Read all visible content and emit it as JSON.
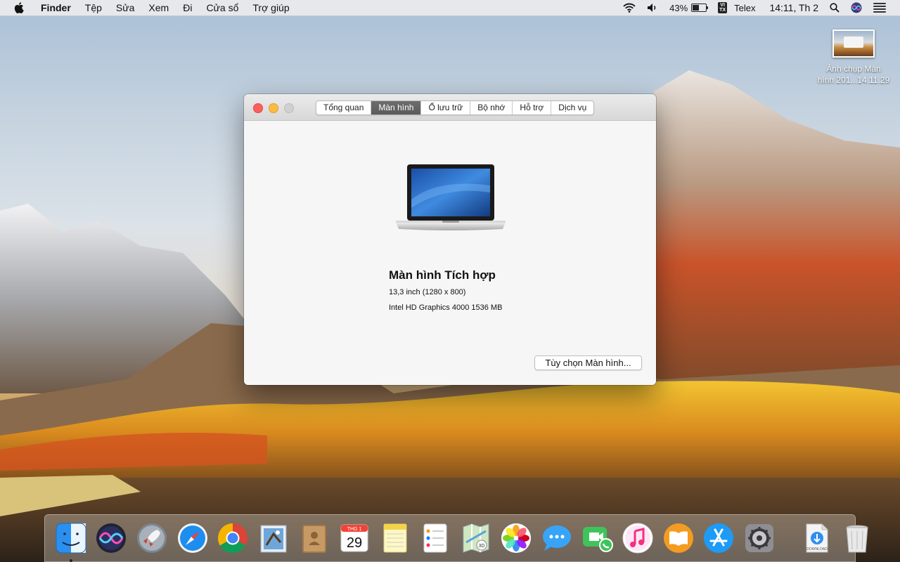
{
  "menubar": {
    "apple_icon": "apple-logo-icon",
    "app_name": "Finder",
    "menus": [
      "Tệp",
      "Sửa",
      "Xem",
      "Đi",
      "Cửa sổ",
      "Trợ giúp"
    ],
    "battery_percent": "43%",
    "battery_level": 0.43,
    "input_badge_top": "VI",
    "input_badge_bottom": "TX",
    "input_method": "Telex",
    "clock": "14:11, Th 2"
  },
  "desktop": {
    "screenshot_file_line1": "Ảnh chụp Màn",
    "screenshot_file_line2": "hình 201...14.11.29"
  },
  "window": {
    "tabs": [
      "Tổng quan",
      "Màn hình",
      "Ổ lưu trữ",
      "Bộ nhớ",
      "Hỗ trợ",
      "Dịch vụ"
    ],
    "active_tab": "Màn hình",
    "display_title": "Màn hình Tích hợp",
    "display_size": "13,3 inch (1280 x 800)",
    "graphics": "Intel HD Graphics 4000 1536 MB",
    "options_button": "Tùy chọn Màn hình..."
  },
  "dock": {
    "apps": [
      "Finder",
      "Siri",
      "Launchpad",
      "Safari",
      "Google Chrome",
      "Mail",
      "Contacts",
      "Calendar",
      "Notes",
      "Reminders",
      "Maps",
      "Photos",
      "Messages",
      "FaceTime",
      "iTunes",
      "iBooks",
      "App Store",
      "System Preferences"
    ],
    "calendar_month": "THG 1",
    "calendar_day": "29",
    "downloads_label": "DOWNLOAD",
    "trash": "Trash"
  },
  "colors": {
    "close": "#fc605c",
    "minimize": "#fdbc40",
    "active_tab": "#606060"
  }
}
